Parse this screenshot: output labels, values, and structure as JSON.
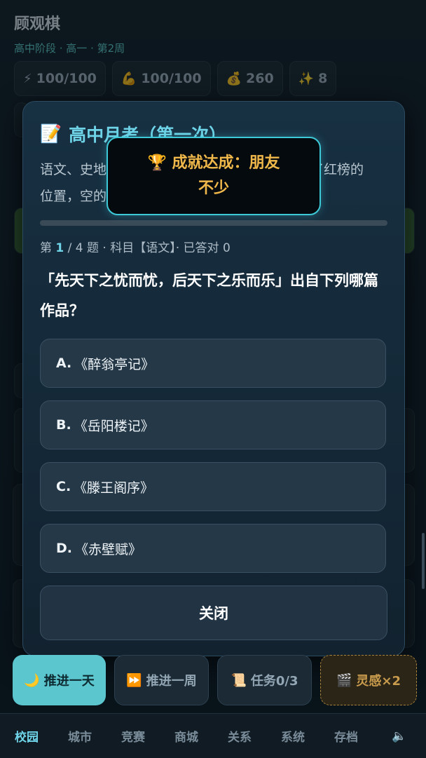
{
  "header": {
    "player_name": "顾观棋",
    "stage_line": "高中阶段 · 高一 · 第2周"
  },
  "stats": [
    {
      "icon": "⚡",
      "icon_name": "energy-icon",
      "value": "100/100"
    },
    {
      "icon": "💪",
      "icon_name": "strength-icon",
      "value": "100/100"
    },
    {
      "icon": "💰",
      "icon_name": "money-bag-icon",
      "value": "260"
    },
    {
      "icon": "✨",
      "icon_name": "sparkle-icon",
      "value": "8"
    }
  ],
  "modal": {
    "icon": "📝",
    "title": "高中月考（第一次）",
    "desc_line1": "语文、史地、数学……班主任已经挂上了 ，出了红榜的",
    "desc_line2": "位置，空的。",
    "progress": 0,
    "question_num": "1",
    "question_total": "4",
    "meta_prefix": "第 ",
    "meta_suffix": " 题 · 科目【语文】· 已答对 0",
    "question": "「先天下之忧而忧，后天下之乐而乐」出自下列哪篇作品？",
    "options": [
      {
        "key": "A.",
        "text": "《醉翁亭记》"
      },
      {
        "key": "B.",
        "text": "《岳阳楼记》"
      },
      {
        "key": "C.",
        "text": "《滕王阁序》"
      },
      {
        "key": "D.",
        "text": "《赤壁赋》"
      }
    ],
    "close_label": "关闭"
  },
  "toast": {
    "icon": "🏆",
    "text_line1": "成就达成：朋友",
    "text_line2": "不少"
  },
  "actions": [
    {
      "icon": "🌙",
      "label": "推进一天"
    },
    {
      "icon": "⏩",
      "label": "推进一周"
    },
    {
      "icon": "📜",
      "label": "任务0/3"
    },
    {
      "icon": "🎬",
      "label": "灵感×2"
    }
  ],
  "nav": [
    "校园",
    "城市",
    "竞赛",
    "商城",
    "关系",
    "系统",
    "存档"
  ],
  "nav_sound_icon": "🔈"
}
